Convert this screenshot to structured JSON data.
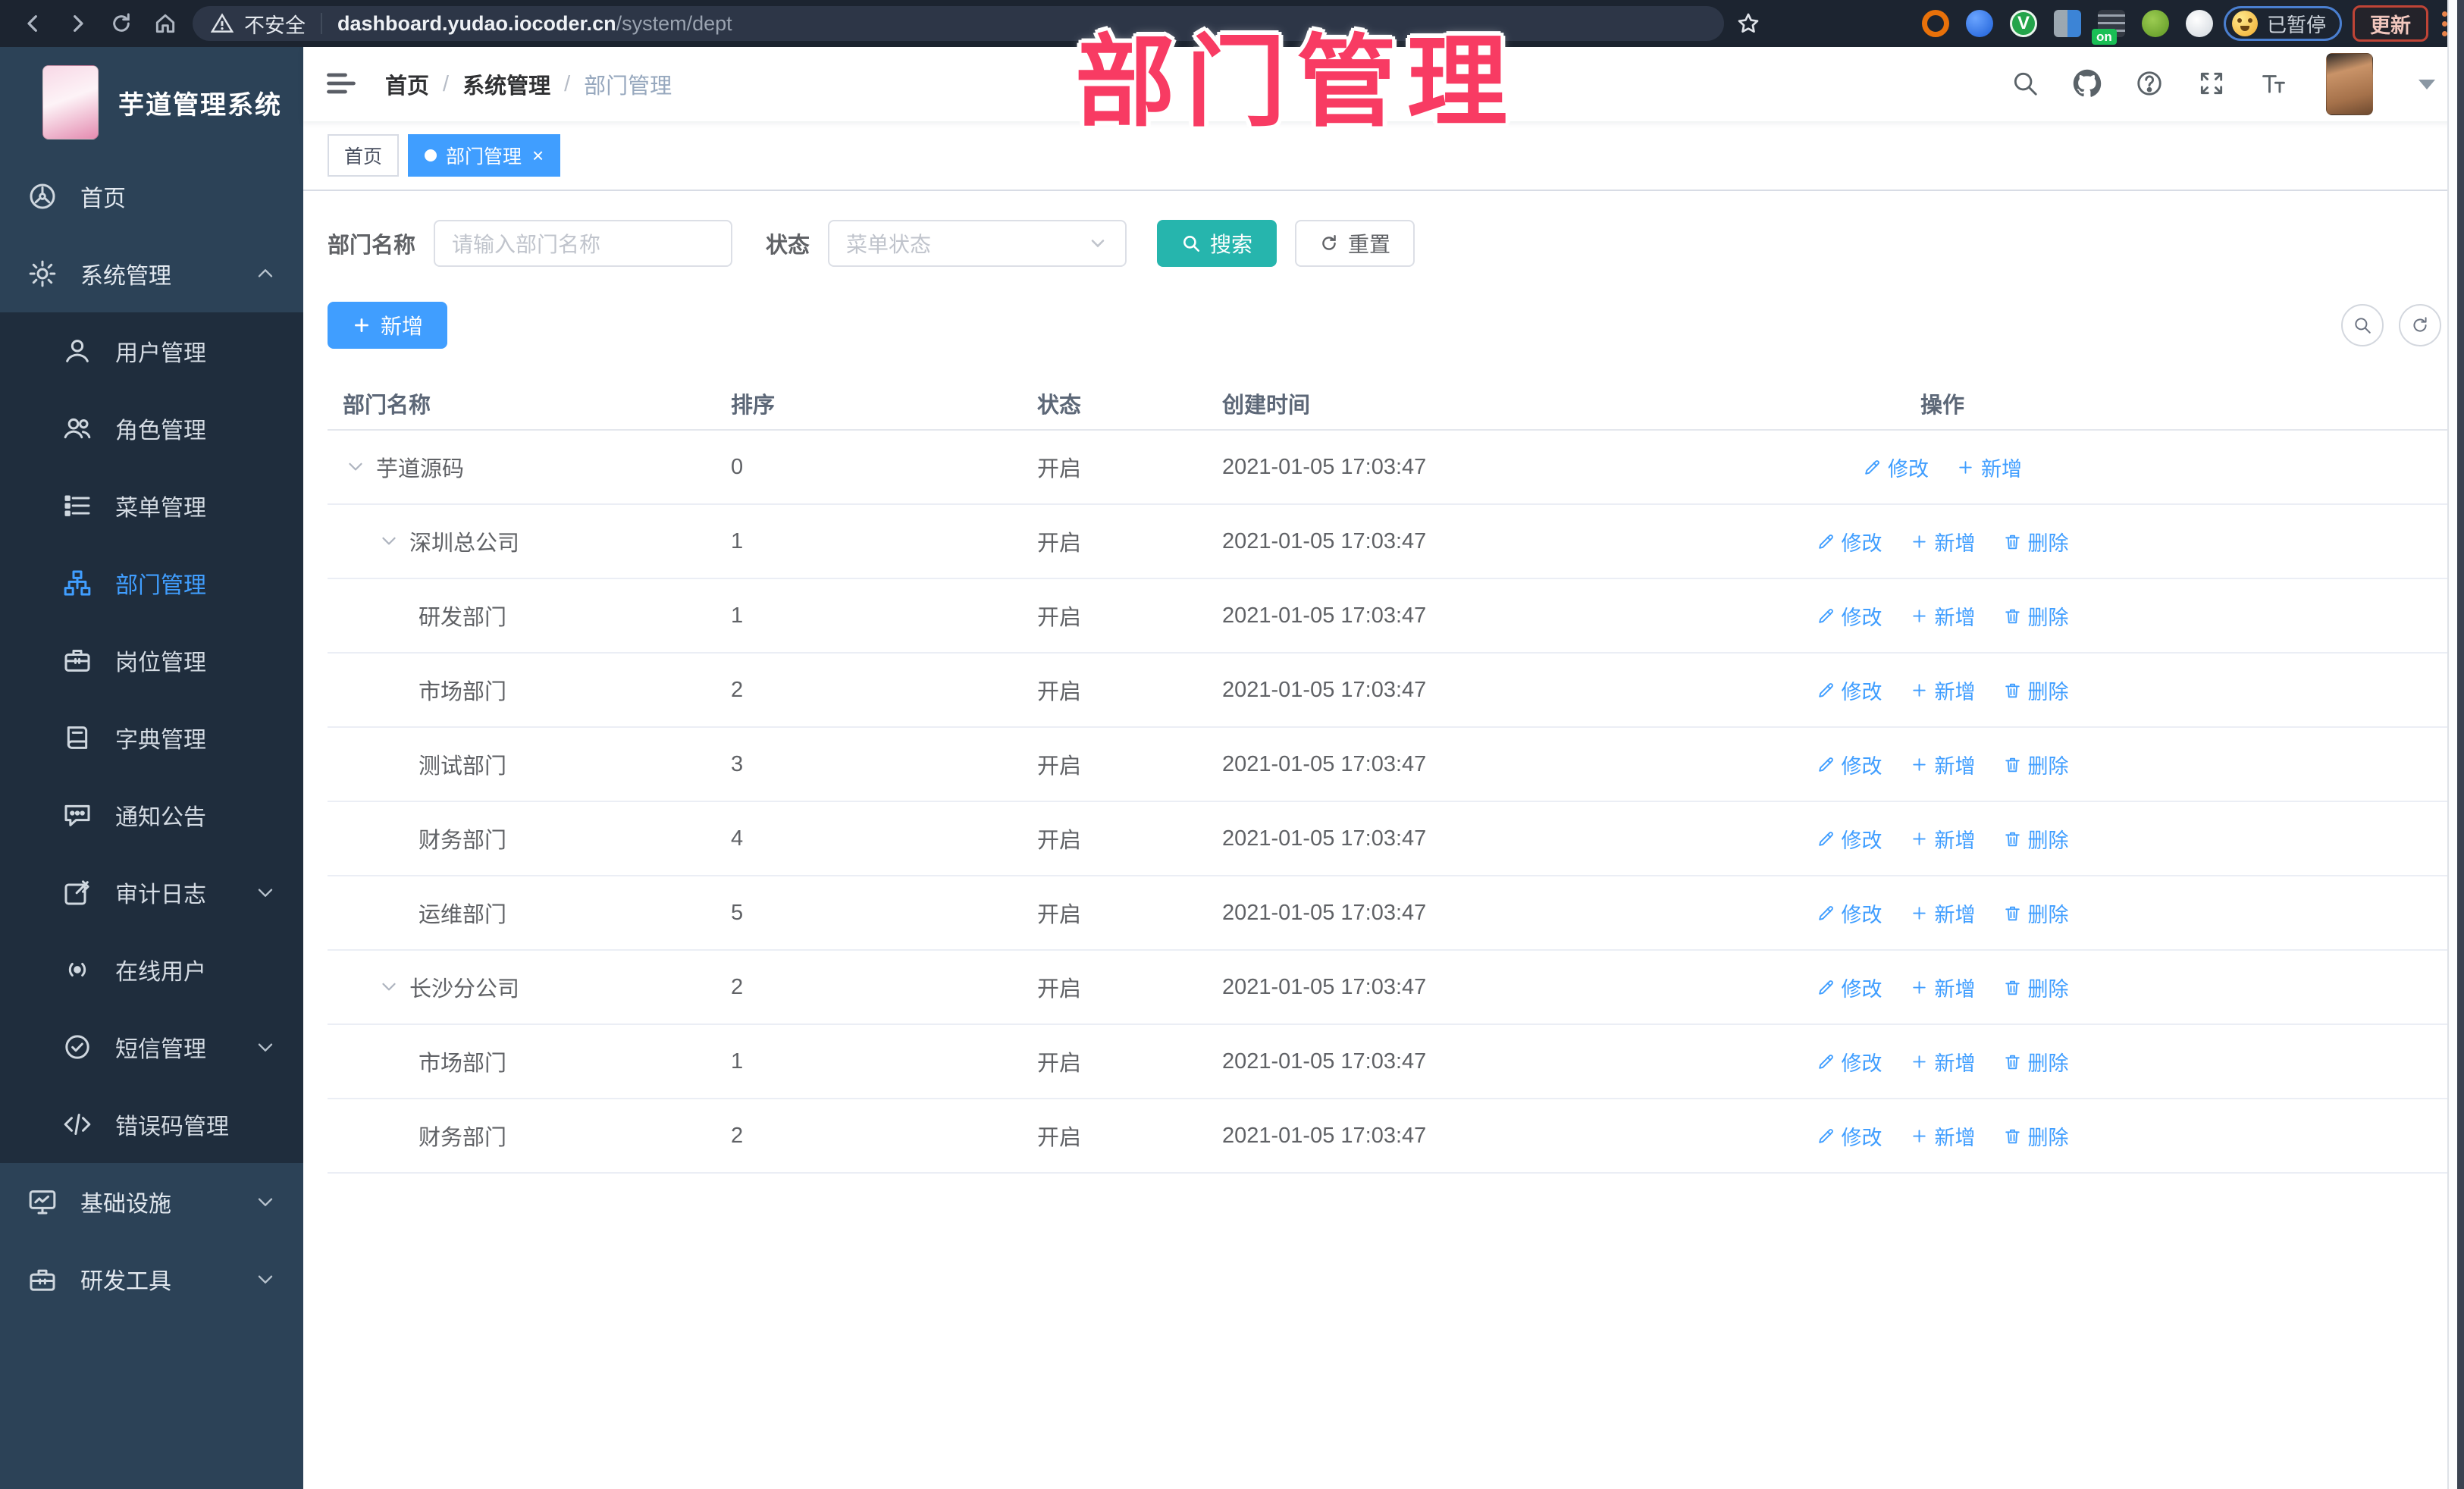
{
  "browser": {
    "insecure_label": "不安全",
    "url_host": "dashboard.yudao.iocoder.cn",
    "url_path": "/system/dept",
    "profile_status": "已暂停",
    "update_label": "更新",
    "nav_icons": [
      "back-icon",
      "forward-icon",
      "reload-icon",
      "home-icon"
    ],
    "extension_icons": [
      "extension-orange-icon",
      "extension-blue-icon",
      "extension-green-check-icon",
      "extension-grid-icon",
      "extension-notes-icon",
      "extension-spy-icon",
      "extension-paw-icon"
    ],
    "extension_badge": "on",
    "extension_check_glyph": "V"
  },
  "sidebar": {
    "logo_title": "芋道管理系统",
    "items": [
      {
        "label": "首页",
        "icon": "dashboard-icon"
      },
      {
        "label": "系统管理",
        "icon": "gear-icon",
        "chevron": "up",
        "children": [
          {
            "label": "用户管理",
            "icon": "user-icon"
          },
          {
            "label": "角色管理",
            "icon": "users-icon"
          },
          {
            "label": "菜单管理",
            "icon": "menu-list-icon"
          },
          {
            "label": "部门管理",
            "icon": "org-tree-icon",
            "active": true
          },
          {
            "label": "岗位管理",
            "icon": "briefcase-icon"
          },
          {
            "label": "字典管理",
            "icon": "dictionary-icon"
          },
          {
            "label": "通知公告",
            "icon": "announcement-icon"
          },
          {
            "label": "审计日志",
            "icon": "audit-log-icon",
            "chevron": "down"
          },
          {
            "label": "在线用户",
            "icon": "online-user-icon"
          },
          {
            "label": "短信管理",
            "icon": "sms-icon",
            "chevron": "down"
          },
          {
            "label": "错误码管理",
            "icon": "error-code-icon"
          }
        ]
      },
      {
        "label": "基础设施",
        "icon": "infrastructure-icon",
        "chevron": "down"
      },
      {
        "label": "研发工具",
        "icon": "devtools-icon",
        "chevron": "down"
      }
    ]
  },
  "navbar": {
    "breadcrumb": [
      "首页",
      "系统管理",
      "部门管理"
    ],
    "breadcrumb_separator": "/",
    "tools": [
      "search-icon",
      "github-icon",
      "help-icon",
      "fullscreen-icon",
      "font-size-icon"
    ]
  },
  "tabs": {
    "close_glyph": "×",
    "items": [
      {
        "label": "首页",
        "active": false,
        "closable": false
      },
      {
        "label": "部门管理",
        "active": true,
        "closable": true
      }
    ]
  },
  "overlay_title": "部门管理",
  "filter": {
    "name_label": "部门名称",
    "name_placeholder": "请输入部门名称",
    "status_label": "状态",
    "status_placeholder": "菜单状态",
    "search_label": "搜索",
    "reset_label": "重置"
  },
  "toolbar": {
    "add_label": "新增",
    "panel_icons": [
      "search-circle-icon",
      "refresh-circle-icon"
    ]
  },
  "table": {
    "columns": [
      "部门名称",
      "排序",
      "状态",
      "创建时间",
      "操作"
    ],
    "action_labels": {
      "edit": "修改",
      "add": "新增",
      "delete": "删除"
    },
    "rows": [
      {
        "name": "芋道源码",
        "level": 0,
        "expandable": true,
        "sort": "0",
        "status": "开启",
        "created": "2021-01-05 17:03:47",
        "actions": [
          "edit",
          "add"
        ]
      },
      {
        "name": "深圳总公司",
        "level": 1,
        "expandable": true,
        "sort": "1",
        "status": "开启",
        "created": "2021-01-05 17:03:47",
        "actions": [
          "edit",
          "add",
          "delete"
        ]
      },
      {
        "name": "研发部门",
        "level": 2,
        "expandable": false,
        "sort": "1",
        "status": "开启",
        "created": "2021-01-05 17:03:47",
        "actions": [
          "edit",
          "add",
          "delete"
        ]
      },
      {
        "name": "市场部门",
        "level": 2,
        "expandable": false,
        "sort": "2",
        "status": "开启",
        "created": "2021-01-05 17:03:47",
        "actions": [
          "edit",
          "add",
          "delete"
        ]
      },
      {
        "name": "测试部门",
        "level": 2,
        "expandable": false,
        "sort": "3",
        "status": "开启",
        "created": "2021-01-05 17:03:47",
        "actions": [
          "edit",
          "add",
          "delete"
        ]
      },
      {
        "name": "财务部门",
        "level": 2,
        "expandable": false,
        "sort": "4",
        "status": "开启",
        "created": "2021-01-05 17:03:47",
        "actions": [
          "edit",
          "add",
          "delete"
        ]
      },
      {
        "name": "运维部门",
        "level": 2,
        "expandable": false,
        "sort": "5",
        "status": "开启",
        "created": "2021-01-05 17:03:47",
        "actions": [
          "edit",
          "add",
          "delete"
        ]
      },
      {
        "name": "长沙分公司",
        "level": 1,
        "expandable": true,
        "sort": "2",
        "status": "开启",
        "created": "2021-01-05 17:03:47",
        "actions": [
          "edit",
          "add",
          "delete"
        ]
      },
      {
        "name": "市场部门",
        "level": 2,
        "expandable": false,
        "sort": "1",
        "status": "开启",
        "created": "2021-01-05 17:03:47",
        "actions": [
          "edit",
          "add",
          "delete"
        ]
      },
      {
        "name": "财务部门",
        "level": 2,
        "expandable": false,
        "sort": "2",
        "status": "开启",
        "created": "2021-01-05 17:03:47",
        "actions": [
          "edit",
          "add",
          "delete"
        ]
      }
    ]
  },
  "colors": {
    "accent_blue": "#409eff",
    "search_teal": "#26b5ad",
    "sidebar_bg": "#2c4257",
    "submenu_bg": "#1f2d3d",
    "overlay_pink": "#f83b63"
  }
}
